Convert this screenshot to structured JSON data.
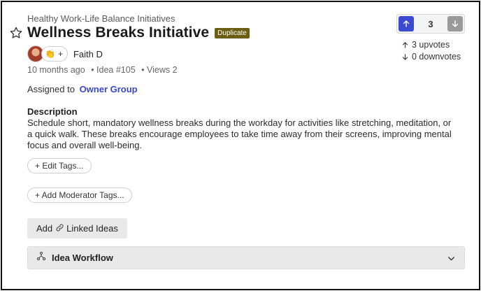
{
  "idea": {
    "category": "Healthy Work-Life Balance Initiatives",
    "title": "Wellness Breaks Initiative",
    "status_badge": "Duplicate",
    "author": "Faith D",
    "reaction_emoji": "👏",
    "reaction_add": "+",
    "time_ago": "10 months ago",
    "idea_number": "• Idea #105",
    "views": "• Views 2",
    "assigned_label": "Assigned to",
    "assigned_group": "Owner Group",
    "description_heading": "Description",
    "description": "Schedule short, mandatory wellness breaks during the workday for activities like stretching, meditation, or a quick walk. These breaks encourage employees to take time away from their screens, improving mental focus and overall well-being."
  },
  "actions": {
    "edit_tags": "+ Edit Tags...",
    "add_moderator_tags": "+ Add Moderator Tags...",
    "add_linked_prefix": "Add",
    "add_linked_suffix": "Linked Ideas",
    "workflow": "Idea Workflow"
  },
  "votes": {
    "count": "3",
    "upvotes": "3 upvotes",
    "downvotes": "0 downvotes"
  },
  "colors": {
    "accent": "#3b4bd1",
    "badge": "#6b5e12",
    "link": "#3a47c9"
  },
  "icons": {
    "favorite": "star-icon",
    "upvote": "arrow-up-icon",
    "downvote": "arrow-down-icon",
    "link": "link-icon",
    "workflow": "workflow-icon",
    "expand": "chevron-down-icon"
  }
}
